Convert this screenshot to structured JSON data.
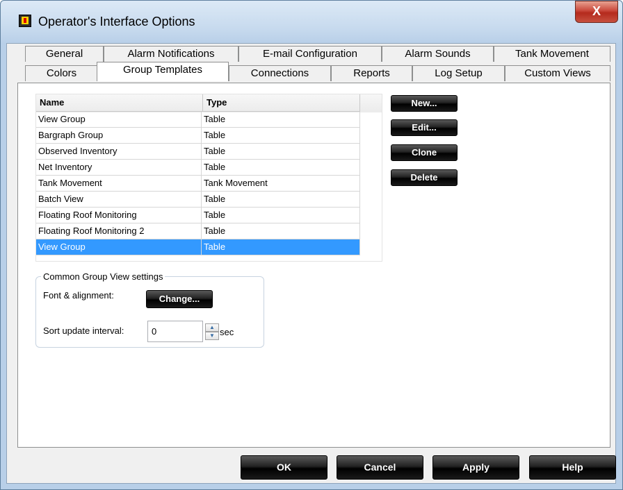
{
  "window": {
    "title": "Operator's Interface Options",
    "close_label": "X"
  },
  "tabs_row1": [
    "General",
    "Alarm Notifications",
    "E-mail Configuration",
    "Alarm Sounds",
    "Tank Movement"
  ],
  "tabs_row2": [
    "Colors",
    "Group Templates",
    "Connections",
    "Reports",
    "Log Setup",
    "Custom Views"
  ],
  "active_tab": "Group Templates",
  "list": {
    "columns": [
      "Name",
      "Type"
    ],
    "rows": [
      {
        "name": "View Group",
        "type": "Table"
      },
      {
        "name": "Bargraph Group",
        "type": "Table"
      },
      {
        "name": "Observed Inventory",
        "type": "Table"
      },
      {
        "name": "Net Inventory",
        "type": "Table"
      },
      {
        "name": "Tank Movement",
        "type": "Tank Movement"
      },
      {
        "name": "Batch View",
        "type": "Table"
      },
      {
        "name": "Floating Roof Monitoring",
        "type": "Table"
      },
      {
        "name": "Floating Roof Monitoring 2",
        "type": "Table"
      },
      {
        "name": "View Group",
        "type": "Table"
      }
    ],
    "selected_index": 8
  },
  "side_buttons": {
    "new_label": "New...",
    "edit_label": "Edit...",
    "clone_label": "Clone",
    "delete_label": "Delete"
  },
  "common_settings": {
    "legend": "Common Group View settings",
    "font_label": "Font & alignment:",
    "change_label": "Change...",
    "sort_label": "Sort update interval:",
    "sort_value": "0",
    "unit": "sec"
  },
  "bottom_buttons": {
    "ok_label": "OK",
    "cancel_label": "Cancel",
    "apply_label": "Apply",
    "help_label": "Help"
  },
  "icons": [
    "app-icon",
    "close-icon",
    "spin-up-icon",
    "spin-down-icon"
  ]
}
